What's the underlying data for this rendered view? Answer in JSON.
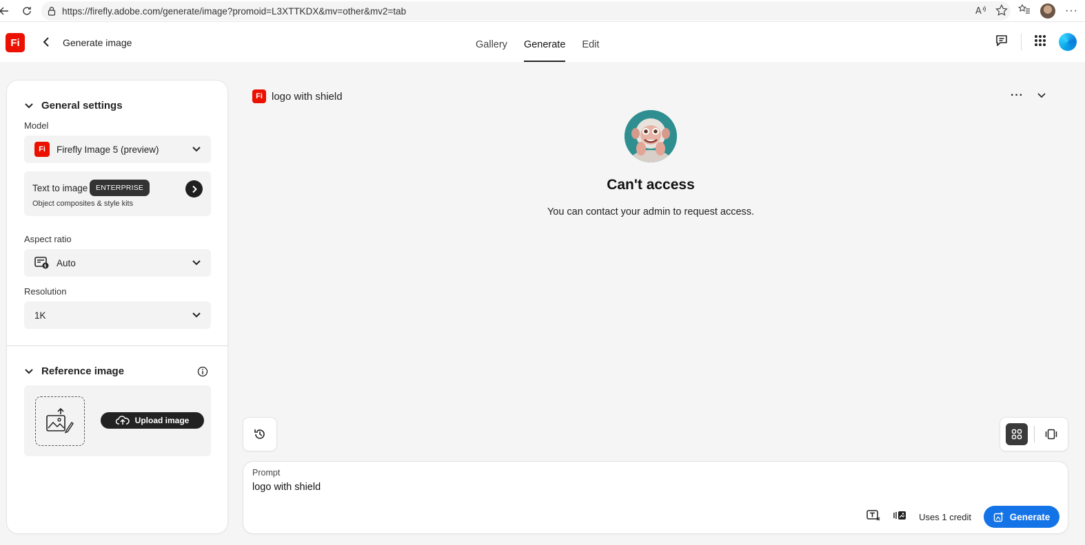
{
  "browser": {
    "url": "https://firefly.adobe.com/generate/image?promoid=L3XTTKDX&mv=other&mv2=tab"
  },
  "header": {
    "logo_text": "Fi",
    "title": "Generate image",
    "tabs": [
      {
        "label": "Gallery"
      },
      {
        "label": "Generate"
      },
      {
        "label": "Edit"
      }
    ]
  },
  "settings": {
    "general_title": "General settings",
    "model_label": "Model",
    "model_value": "Firefly Image 5 (preview)",
    "model_logo": "Fi",
    "t2i_title": "Text to image",
    "t2i_badge": "ENTERPRISE",
    "t2i_sub": "Object composites & style kits",
    "aspect_label": "Aspect ratio",
    "aspect_value": "Auto",
    "resolution_label": "Resolution",
    "resolution_value": "1K",
    "reference_title": "Reference image",
    "upload_label": "Upload image"
  },
  "main": {
    "logo_text": "Fi",
    "title": "logo with shield",
    "access_title": "Can't access",
    "access_message": "You can contact your admin to request access."
  },
  "prompt": {
    "label": "Prompt",
    "value": "logo with shield",
    "credits": "Uses 1 credit",
    "generate_label": "Generate"
  },
  "colors": {
    "brand_red": "#eb1000",
    "accent_blue": "#1473e6"
  }
}
